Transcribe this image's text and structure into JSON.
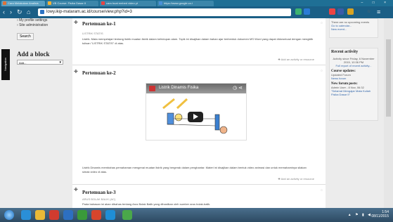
{
  "browser": {
    "tabs": [
      {
        "label": "Cara Melakukan Analisis",
        "color": "#e0733a"
      },
      {
        "label": "VB Course: Fisika Dasar II",
        "color": "#f2b233"
      },
      {
        "label": "cara buat embed video yt",
        "color": "#e64343"
      },
      {
        "label": "https://www.google.co.i",
        "color": "#4a90d9"
      }
    ],
    "url": "lowy.ikip-mataram.ac.id/course/view.php?id=3",
    "window_controls": "– □ ×"
  },
  "left": {
    "menu": [
      "My profile settings",
      "Site administration"
    ],
    "search_label": "Search",
    "add_block_title": "Add a block",
    "add_select": "Add...",
    "nav_tab": "Navigation"
  },
  "sections": [
    {
      "title": "Pertemuan ke-1",
      "subtitle": "LISTRIK STATIS",
      "text": "Listrik. Mata mempelajari tentang listrik muatan listrik dalam kehidupan alam. Topik ini disajikan dalam bahan ajar berbentuk dokumen MS Word yang dapat didownload dengan mengklik tulisan \"LISTRIK STATIS\" di atas.",
      "add_activity": "✚ Add an activity or resource"
    },
    {
      "title": "Pertemuan ke-2",
      "video_title": "Listrik Dinamis Fisika",
      "text": "Listrik Dinamis membahas pemahaman mengenai muatan listrik yang bergerak dalam penghantar. Materi ini disajikan dalam bentuk video animasi dan untuk memahaminya silakan simak video di atas.",
      "add_activity": "✚ Add an activity or resource"
    },
    {
      "title": "Pertemuan ke-3",
      "subtitle": "ARUS BOLAK BALIK (AC)",
      "text": "Pada bahasan ini akan dibahas tentang Arus Bolak Balik yang dihasilkan oleh sumber arus bolak-balik."
    }
  ],
  "right": {
    "upcoming": {
      "text": "There are no upcoming events",
      "links": [
        "Go to calendar...",
        "New event..."
      ]
    },
    "recent": {
      "title": "Recent activity",
      "since": "Activity since Friday, 6 November 2015, 10:36 PM",
      "full_report": "Full report of recent activity...",
      "course_updates": "Course updates:",
      "updated": "Updated Forum",
      "news": "News forum",
      "forum_title": "New forum posts:",
      "forum_meta": "Admin User - 8 Nov, 06:32",
      "forum_link": "\"Selamat Mengajar Mata Kuliah Fisika Dasar II\""
    }
  },
  "taskbar": {
    "time": "1:54",
    "date": "08/11/2015",
    "tray": "▲ ⚑ ▮ ◀"
  }
}
